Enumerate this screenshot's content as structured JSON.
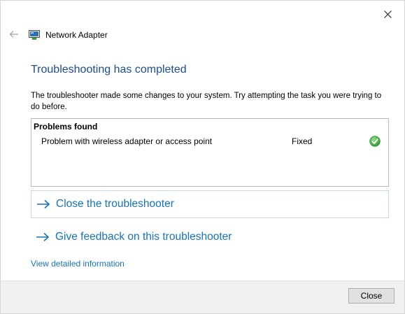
{
  "window": {
    "app_title": "Network Adapter"
  },
  "icons": {
    "close": "close-icon",
    "back": "back-arrow-icon",
    "app": "network-adapter-icon",
    "status": "check-icon",
    "link_arrow": "arrow-right-icon"
  },
  "main": {
    "heading": "Troubleshooting has completed",
    "description": "The troubleshooter made some changes to your system. Try attempting the task you were trying to do before."
  },
  "problems": {
    "title": "Problems found",
    "items": [
      {
        "description": "Problem with wireless adapter or access point",
        "status": "Fixed"
      }
    ]
  },
  "actions": {
    "close_troubleshooter": "Close the troubleshooter",
    "give_feedback": "Give feedback on this troubleshooter",
    "view_details": "View detailed information"
  },
  "footer": {
    "close_label": "Close"
  },
  "colors": {
    "heading": "#1b4d8f",
    "link": "#1673bd",
    "success": "#3aa63a",
    "footer_bg": "#f0f0f0"
  }
}
